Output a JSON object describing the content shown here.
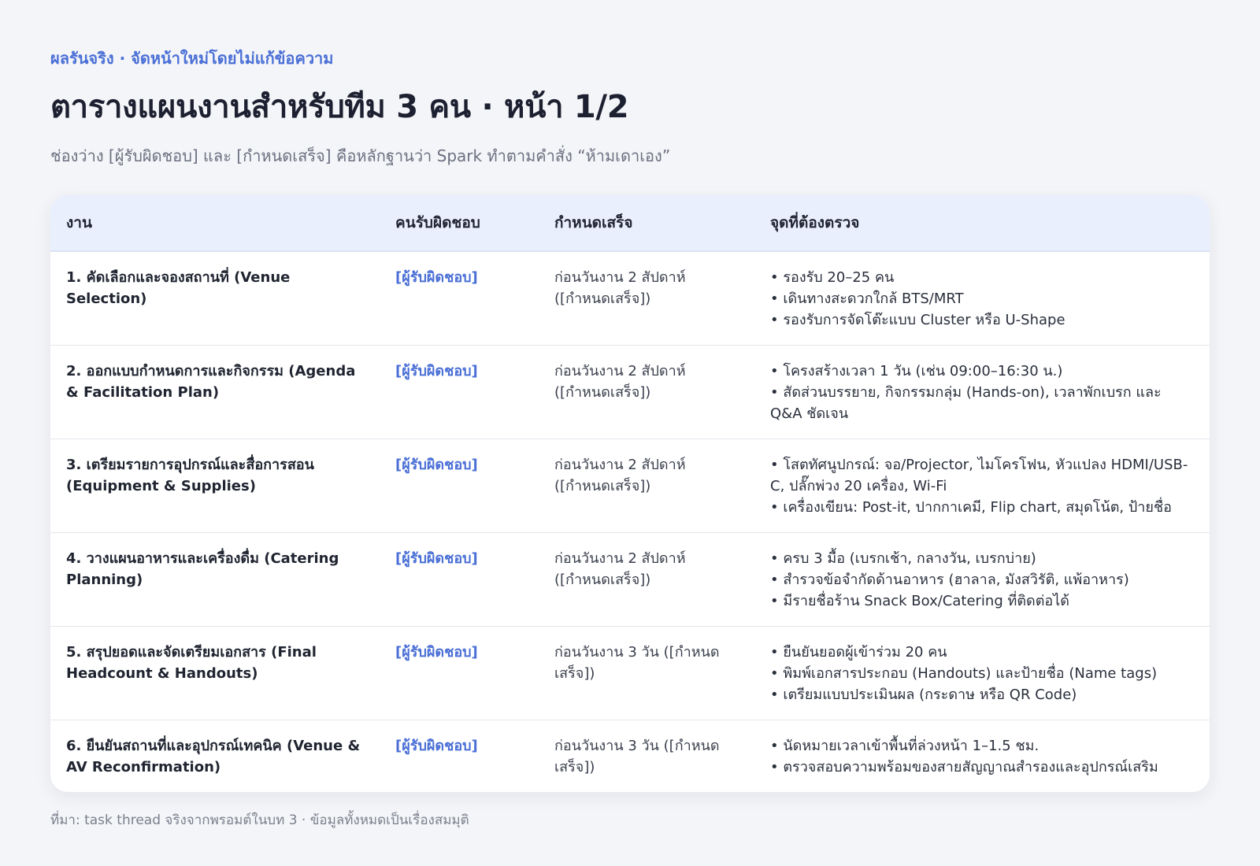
{
  "header": {
    "eyebrow": "ผลรันจริง · จัดหน้าใหม่โดยไม่แก้ข้อความ",
    "title": "ตารางแผนงานสำหรับทีม 3 คน · หน้า 1/2",
    "subtitle": "ช่องว่าง [ผู้รับผิดชอบ] และ [กำหนดเสร็จ] คือหลักฐานว่า Spark ทำตามคำสั่ง “ห้ามเดาเอง”"
  },
  "table": {
    "columns": [
      "งาน",
      "คนรับผิดชอบ",
      "กำหนดเสร็จ",
      "จุดที่ต้องตรวจ"
    ],
    "rows": [
      {
        "task": "1. คัดเลือกและจองสถานที่ (Venue Selection)",
        "owner": "[ผู้รับผิดชอบ]",
        "due": "ก่อนวันงาน 2 สัปดาห์ ([กำหนดเสร็จ])",
        "checks": [
          "• รองรับ 20–25 คน",
          "• เดินทางสะดวกใกล้ BTS/MRT",
          "• รองรับการจัดโต๊ะแบบ Cluster หรือ U-Shape"
        ]
      },
      {
        "task": "2. ออกแบบกำหนดการและกิจกรรม (Agenda & Facilitation Plan)",
        "owner": "[ผู้รับผิดชอบ]",
        "due": "ก่อนวันงาน 2 สัปดาห์ ([กำหนดเสร็จ])",
        "checks": [
          "• โครงสร้างเวลา 1 วัน (เช่น 09:00–16:30 น.)",
          "• สัดส่วนบรรยาย, กิจกรรมกลุ่ม (Hands-on), เวลาพักเบรก และ Q&A ชัดเจน"
        ]
      },
      {
        "task": "3. เตรียมรายการอุปกรณ์และสื่อการสอน (Equipment & Supplies)",
        "owner": "[ผู้รับผิดชอบ]",
        "due": "ก่อนวันงาน 2 สัปดาห์ ([กำหนดเสร็จ])",
        "checks": [
          "• โสตทัศนูปกรณ์: จอ/Projector, ไมโครโฟน, หัวแปลง HDMI/USB-C, ปลั๊กพ่วง 20 เครื่อง, Wi-Fi",
          "• เครื่องเขียน: Post-it, ปากกาเคมี, Flip chart, สมุดโน้ต, ป้ายชื่อ"
        ]
      },
      {
        "task": "4. วางแผนอาหารและเครื่องดื่ม (Catering Planning)",
        "owner": "[ผู้รับผิดชอบ]",
        "due": "ก่อนวันงาน 2 สัปดาห์ ([กำหนดเสร็จ])",
        "checks": [
          "• ครบ 3 มื้อ (เบรกเช้า, กลางวัน, เบรกบ่าย)",
          "• สำรวจข้อจำกัดด้านอาหาร (ฮาลาล, มังสวิรัติ, แพ้อาหาร)",
          "• มีรายชื่อร้าน Snack Box/Catering ที่ติดต่อได้"
        ]
      },
      {
        "task": "5. สรุปยอดและจัดเตรียมเอกสาร (Final Headcount & Handouts)",
        "owner": "[ผู้รับผิดชอบ]",
        "due": "ก่อนวันงาน 3 วัน ([กำหนดเสร็จ])",
        "checks": [
          "• ยืนยันยอดผู้เข้าร่วม 20 คน",
          "• พิมพ์เอกสารประกอบ (Handouts) และป้ายชื่อ (Name tags)",
          "• เตรียมแบบประเมินผล (กระดาษ หรือ QR Code)"
        ]
      },
      {
        "task": "6. ยืนยันสถานที่และอุปกรณ์เทคนิค (Venue & AV Reconfirmation)",
        "owner": "[ผู้รับผิดชอบ]",
        "due": "ก่อนวันงาน 3 วัน ([กำหนดเสร็จ])",
        "checks": [
          "• นัดหมายเวลาเข้าพื้นที่ล่วงหน้า 1–1.5 ชม.",
          "• ตรวจสอบความพร้อมของสายสัญญาณสำรองและอุปกรณ์เสริม"
        ]
      }
    ]
  },
  "footer": {
    "source": "ที่มา: task thread จริงจากพรอมต์ในบท 3 · ข้อมูลทั้งหมดเป็นเรื่องสมมุติ"
  }
}
